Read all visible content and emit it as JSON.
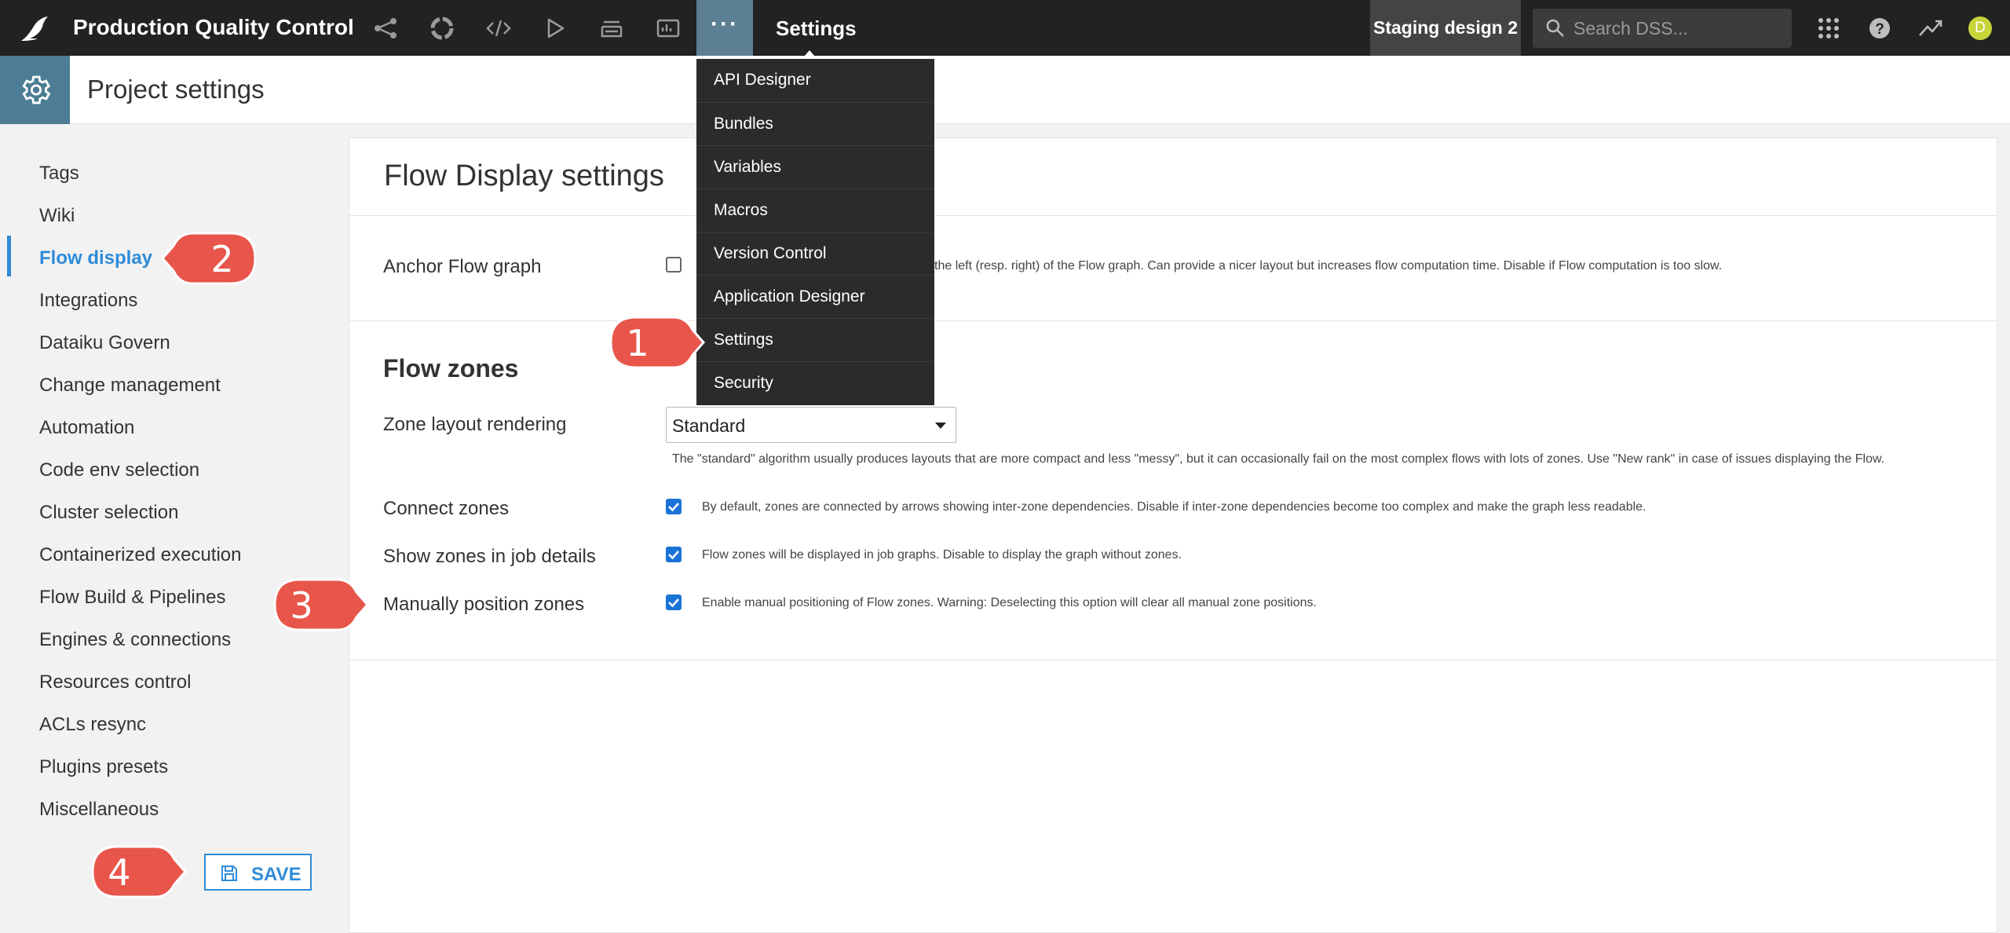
{
  "topbar": {
    "project_name": "Production Quality Control",
    "more_label": "···",
    "section_title": "Settings",
    "instance_badge": "Staging design 2",
    "search_placeholder": "Search DSS...",
    "avatar_initial": "D",
    "colors": {
      "bar": "#222222",
      "more_active": "#5c7f94",
      "avatar": "#c7d43a"
    },
    "icons": [
      "flow-icon",
      "data-quality-icon",
      "code-icon",
      "run-icon",
      "deployer-icon",
      "dashboard-icon"
    ]
  },
  "header": {
    "title": "Project settings",
    "icon": "gear-icon"
  },
  "sidebar": {
    "items": [
      {
        "label": "Tags"
      },
      {
        "label": "Wiki"
      },
      {
        "label": "Flow display",
        "active": true
      },
      {
        "label": "Integrations"
      },
      {
        "label": "Dataiku Govern"
      },
      {
        "label": "Change management"
      },
      {
        "label": "Automation"
      },
      {
        "label": "Code env selection"
      },
      {
        "label": "Cluster selection"
      },
      {
        "label": "Containerized execution"
      },
      {
        "label": "Flow Build & Pipelines"
      },
      {
        "label": "Engines & connections"
      },
      {
        "label": "Resources control"
      },
      {
        "label": "ACLs resync"
      },
      {
        "label": "Plugins presets"
      },
      {
        "label": "Miscellaneous"
      }
    ],
    "save_label": "SAVE",
    "accent": "#2f8bd8"
  },
  "menu": {
    "items": [
      {
        "label": "API Designer"
      },
      {
        "label": "Bundles"
      },
      {
        "label": "Variables"
      },
      {
        "label": "Macros"
      },
      {
        "label": "Version Control"
      },
      {
        "label": "Application Designer"
      },
      {
        "label": "Settings"
      },
      {
        "label": "Security"
      }
    ]
  },
  "main": {
    "title": "Flow Display settings",
    "anchor": {
      "label": "Anchor Flow graph",
      "checked": false,
      "description": "the left (resp. right) of the Flow graph. Can provide a nicer layout but increases flow computation time. Disable if Flow computation is too slow."
    },
    "zones": {
      "heading": "Flow zones",
      "layout_label": "Zone layout rendering",
      "layout_value": "Standard",
      "layout_description": "The \"standard\" algorithm usually produces layouts that are more compact and less \"messy\", but it can occasionally fail on the most complex flows with lots of zones. Use \"New rank\" in case of issues displaying the Flow.",
      "connect": {
        "label": "Connect zones",
        "checked": true,
        "description": "By default, zones are connected by arrows showing inter-zone dependencies. Disable if inter-zone dependencies become too complex and make the graph less readable."
      },
      "show_in_jobs": {
        "label": "Show zones in job details",
        "checked": true,
        "description": "Flow zones will be displayed in job graphs. Disable to display the graph without zones."
      },
      "manual_position": {
        "label": "Manually position zones",
        "checked": true,
        "description": "Enable manual positioning of Flow zones. Warning: Deselecting this option will clear all manual zone positions."
      }
    }
  },
  "callouts": [
    {
      "number": "1"
    },
    {
      "number": "2"
    },
    {
      "number": "3"
    },
    {
      "number": "4"
    }
  ]
}
